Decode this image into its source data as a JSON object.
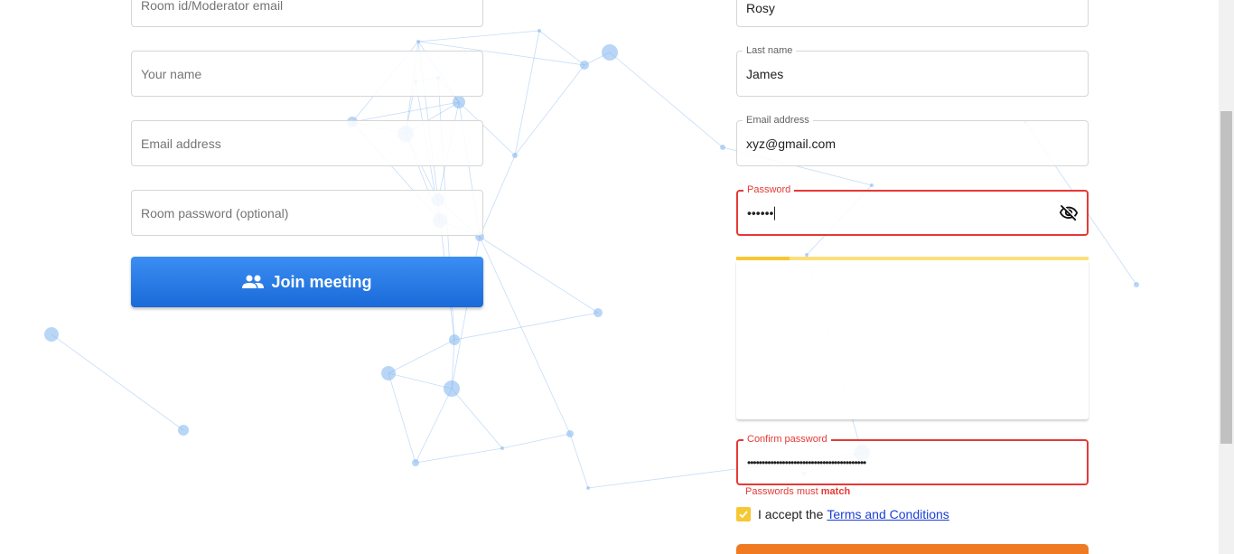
{
  "join_form": {
    "room_id_placeholder": "Room id/Moderator email",
    "name_placeholder": "Your name",
    "email_placeholder": "Email address",
    "room_password_placeholder": "Room password (optional)",
    "join_button_label": "Join meeting",
    "join_icon": "people-icon"
  },
  "signup_form": {
    "first_name_value": "Rosy",
    "last_name_label": "Last name",
    "last_name_value": "James",
    "email_label": "Email address",
    "email_value": "xyz@gmail.com",
    "password_label": "Password",
    "password_value": "••••••",
    "password_visibility_icon": "eye-off-icon",
    "password_strength": 0.15,
    "confirm_password_label": "Confirm password",
    "confirm_password_value": "•••••••••••••••••••••••••••••••••••••••••",
    "error_prefix": "Passwords must",
    "error_bold": "match",
    "terms_prefix": "I accept the",
    "terms_link": "Terms and Conditions",
    "terms_checked": true
  },
  "colors": {
    "primary_blue": "#1a6ad9",
    "error_red": "#e53935",
    "warning_yellow": "#f6c833",
    "accent_orange": "#f07a22",
    "network_blue": "#7fb4ee"
  }
}
